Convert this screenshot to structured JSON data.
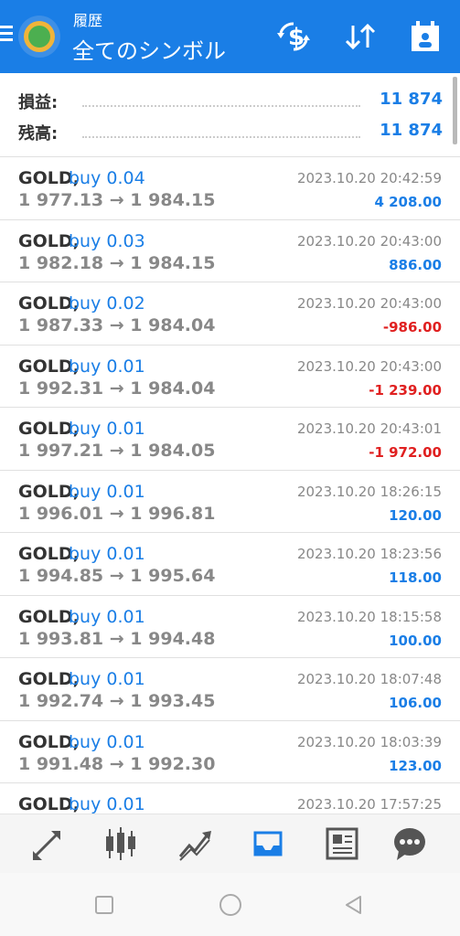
{
  "header": {
    "subtitle": "履歴",
    "title": "全てのシンボル"
  },
  "summary": {
    "profit_label": "損益:",
    "profit_value": "11 874",
    "balance_label": "残高:",
    "balance_value": "11 874"
  },
  "trades": [
    {
      "symbol": "GOLD,",
      "side": "buy 0.04",
      "prices": "1 977.13 → 1 984.15",
      "time": "2023.10.20 20:42:59",
      "pnl": "4 208.00",
      "sign": "pos"
    },
    {
      "symbol": "GOLD,",
      "side": "buy 0.03",
      "prices": "1 982.18 → 1 984.15",
      "time": "2023.10.20 20:43:00",
      "pnl": "886.00",
      "sign": "pos"
    },
    {
      "symbol": "GOLD,",
      "side": "buy 0.02",
      "prices": "1 987.33 → 1 984.04",
      "time": "2023.10.20 20:43:00",
      "pnl": "-986.00",
      "sign": "neg"
    },
    {
      "symbol": "GOLD,",
      "side": "buy 0.01",
      "prices": "1 992.31 → 1 984.04",
      "time": "2023.10.20 20:43:00",
      "pnl": "-1 239.00",
      "sign": "neg"
    },
    {
      "symbol": "GOLD,",
      "side": "buy 0.01",
      "prices": "1 997.21 → 1 984.05",
      "time": "2023.10.20 20:43:01",
      "pnl": "-1 972.00",
      "sign": "neg"
    },
    {
      "symbol": "GOLD,",
      "side": "buy 0.01",
      "prices": "1 996.01 → 1 996.81",
      "time": "2023.10.20 18:26:15",
      "pnl": "120.00",
      "sign": "pos"
    },
    {
      "symbol": "GOLD,",
      "side": "buy 0.01",
      "prices": "1 994.85 → 1 995.64",
      "time": "2023.10.20 18:23:56",
      "pnl": "118.00",
      "sign": "pos"
    },
    {
      "symbol": "GOLD,",
      "side": "buy 0.01",
      "prices": "1 993.81 → 1 994.48",
      "time": "2023.10.20 18:15:58",
      "pnl": "100.00",
      "sign": "pos"
    },
    {
      "symbol": "GOLD,",
      "side": "buy 0.01",
      "prices": "1 992.74 → 1 993.45",
      "time": "2023.10.20 18:07:48",
      "pnl": "106.00",
      "sign": "pos"
    },
    {
      "symbol": "GOLD,",
      "side": "buy 0.01",
      "prices": "1 991.48 → 1 992.30",
      "time": "2023.10.20 18:03:39",
      "pnl": "123.00",
      "sign": "pos"
    },
    {
      "symbol": "GOLD,",
      "side": "buy 0.01",
      "prices": "",
      "time": "2023.10.20 17:57:25",
      "pnl": "",
      "sign": "pos"
    }
  ],
  "icons": {
    "header": [
      "menu-icon",
      "app-logo",
      "currency-exchange-icon",
      "sort-icon",
      "calendar-icon"
    ],
    "bottom_nav": [
      "quotes-icon",
      "chart-icon",
      "trade-icon",
      "history-icon",
      "news-icon",
      "chat-icon"
    ],
    "system_nav": [
      "recent-apps-icon",
      "home-icon",
      "back-icon"
    ]
  },
  "colors": {
    "accent": "#1a7ee6",
    "negative": "#e02020",
    "active_nav": "#1a7ee6",
    "inactive_nav": "#555555"
  },
  "active_tab": "history-icon"
}
